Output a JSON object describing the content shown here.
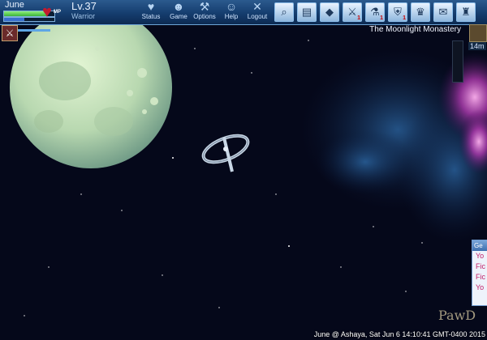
{
  "player": {
    "name": "June",
    "level": "Lv.37",
    "class": "Warrior",
    "hp_fraction": 0.85,
    "mp_label": "MP",
    "mp_fraction": 0.4
  },
  "menu": [
    {
      "label": "Status",
      "icon": "heart-icon"
    },
    {
      "label": "Game",
      "icon": "controller-icon"
    },
    {
      "label": "Options",
      "icon": "wrench-icon"
    },
    {
      "label": "Help",
      "icon": "help-icon"
    },
    {
      "label": "Logout",
      "icon": "close-icon"
    }
  ],
  "toolbar": [
    {
      "icon": "search-icon",
      "badge": ""
    },
    {
      "icon": "map-icon",
      "badge": ""
    },
    {
      "icon": "badge-icon",
      "badge": ""
    },
    {
      "icon": "weapon-icon",
      "badge": "1"
    },
    {
      "icon": "potion-icon",
      "badge": "1"
    },
    {
      "icon": "shield-icon",
      "badge": "1"
    },
    {
      "icon": "crown-icon",
      "badge": ""
    },
    {
      "icon": "mail-icon",
      "badge": ""
    },
    {
      "icon": "bag-icon",
      "badge": ""
    }
  ],
  "location": {
    "name": "The Moonlight Monastery",
    "distance": "14m"
  },
  "chat": {
    "header": "Ge",
    "lines": [
      "Yo",
      "Fic",
      "Fic",
      "Yo"
    ]
  },
  "status_line": "June @ Ashaya, Sat Jun 6 14:10:41 GMT-0400 2015",
  "watermark": "PawD",
  "colors": {
    "accent": "#2b5a8e",
    "hp": "#3bb23a",
    "mp": "#3a6fcf",
    "space": "#05081a"
  }
}
